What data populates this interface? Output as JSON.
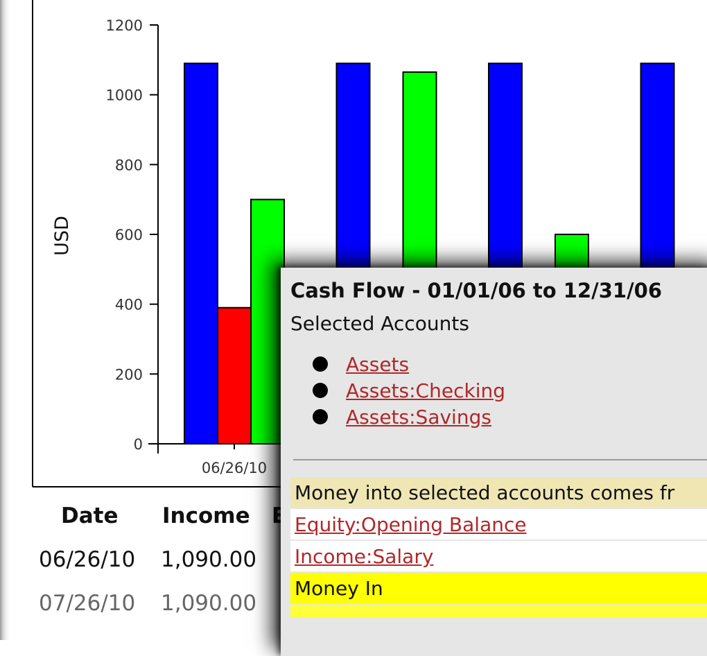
{
  "chart_data": {
    "type": "bar",
    "ylabel": "USD",
    "ylim": [
      0,
      1200
    ],
    "yticks": [
      0,
      200,
      400,
      600,
      800,
      1000,
      1200
    ],
    "categories": [
      "06/26/10",
      "",
      "",
      ""
    ],
    "colors": [
      "#0000ff",
      "#ff0000",
      "#00ff00"
    ],
    "series": [
      {
        "values": [
          1090,
          1090,
          1090,
          1090
        ]
      },
      {
        "values": [
          390,
          null,
          null,
          null
        ]
      },
      {
        "values": [
          700,
          1065,
          600,
          null
        ]
      }
    ]
  },
  "table": {
    "headers": [
      "Date",
      "Income",
      "E"
    ],
    "rows": [
      {
        "date": "06/26/10",
        "income": "1,090.00"
      },
      {
        "date": "07/26/10",
        "income": "1,090.00"
      }
    ]
  },
  "popup": {
    "title": "Cash Flow - 01/01/06 to 12/31/06",
    "subtitle": "Selected Accounts",
    "accounts": [
      "Assets",
      "Assets:Checking",
      "Assets:Savings"
    ],
    "money_in_header": "Money into selected accounts comes fr",
    "money_in_accounts": [
      "Equity:Opening Balance",
      "Income:Salary"
    ],
    "money_in_total_label": "Money In"
  }
}
